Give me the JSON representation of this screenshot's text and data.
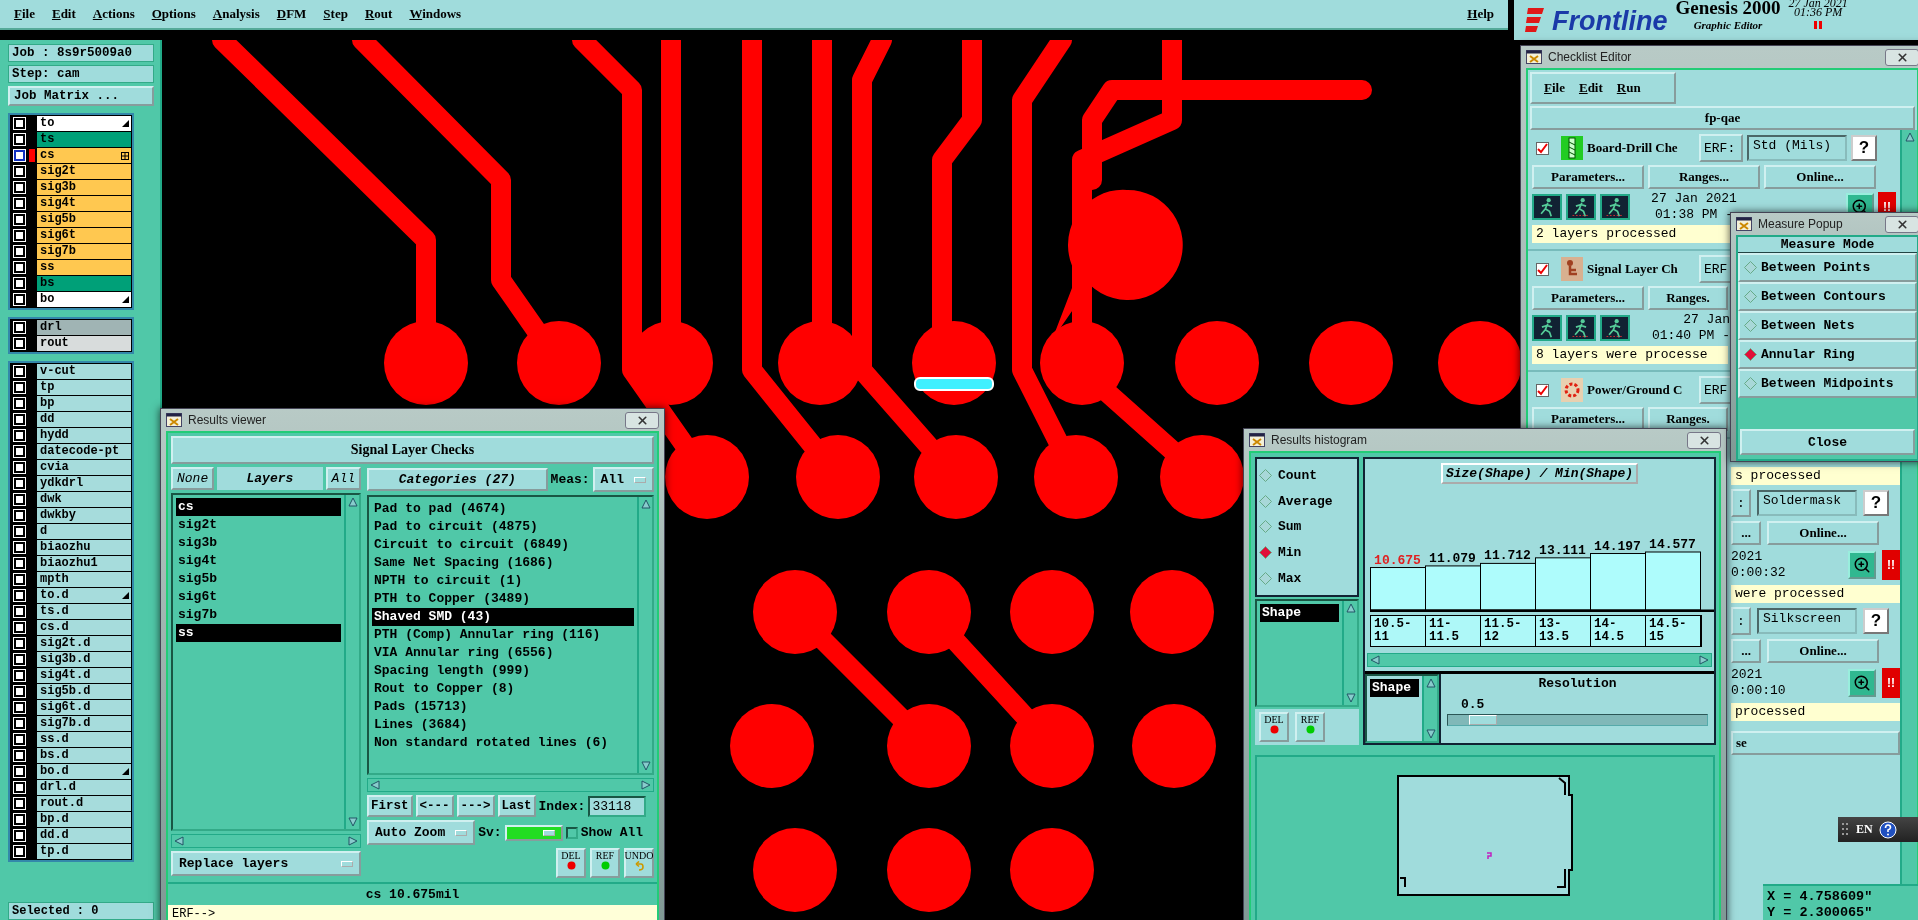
{
  "menu_bar": {
    "items": [
      "File",
      "Edit",
      "Actions",
      "Options",
      "Analysis",
      "DFM",
      "Step",
      "Rout",
      "Windows"
    ],
    "help": "Help"
  },
  "brand": {
    "logo": "Frontline",
    "product": "Genesis 2000",
    "subtitle": "Graphic Editor",
    "date": "27 Jan 2021",
    "time": "01:36 PM"
  },
  "job_panel": {
    "job": "Job : 8s9r5009a0",
    "step": "Step: cam",
    "matrix_button": "Job Matrix ...",
    "layer_groups": [
      [
        {
          "name": "to",
          "color": "#ffffff",
          "checked": false,
          "active": false,
          "marked": true
        },
        {
          "name": "ts",
          "color": "#00a078",
          "checked": false,
          "active": false,
          "marked": false
        },
        {
          "name": "cs",
          "color": "#ffc850",
          "checked": false,
          "active": true,
          "marked": false
        },
        {
          "name": "sig2t",
          "color": "#ffc850",
          "checked": false,
          "active": false,
          "marked": false
        },
        {
          "name": "sig3b",
          "color": "#ffc850",
          "checked": false,
          "active": false,
          "marked": false
        },
        {
          "name": "sig4t",
          "color": "#ffc850",
          "checked": false,
          "active": false,
          "marked": false
        },
        {
          "name": "sig5b",
          "color": "#ffc850",
          "checked": false,
          "active": false,
          "marked": false
        },
        {
          "name": "sig6t",
          "color": "#ffc850",
          "checked": false,
          "active": false,
          "marked": false
        },
        {
          "name": "sig7b",
          "color": "#ffc850",
          "checked": false,
          "active": false,
          "marked": false
        },
        {
          "name": "ss",
          "color": "#ffc850",
          "checked": false,
          "active": false,
          "marked": false
        },
        {
          "name": "bs",
          "color": "#00a078",
          "checked": false,
          "active": false,
          "marked": false
        },
        {
          "name": "bo",
          "color": "#ffffff",
          "checked": false,
          "active": false,
          "marked": true
        }
      ],
      [
        {
          "name": "drl",
          "color": "#a0b4b4",
          "checked": false,
          "active": false,
          "marked": false
        },
        {
          "name": "rout",
          "color": "#d8dcdc",
          "checked": false,
          "active": false,
          "marked": false
        }
      ],
      [
        {
          "name": "v-cut",
          "color": "#a6dcdc",
          "checked": false,
          "active": false,
          "marked": false
        },
        {
          "name": "tp",
          "color": "#a6dcdc",
          "checked": false,
          "active": false,
          "marked": false
        },
        {
          "name": "bp",
          "color": "#a6dcdc",
          "checked": false,
          "active": false,
          "marked": false
        },
        {
          "name": "dd",
          "color": "#a6dcdc",
          "checked": false,
          "active": false,
          "marked": false
        },
        {
          "name": "hydd",
          "color": "#a6dcdc",
          "checked": false,
          "active": false,
          "marked": false
        },
        {
          "name": "datecode-pt",
          "color": "#a6dcdc",
          "checked": false,
          "active": false,
          "marked": false
        },
        {
          "name": "cvia",
          "color": "#a6dcdc",
          "checked": false,
          "active": false,
          "marked": false
        },
        {
          "name": "ydkdrl",
          "color": "#a6dcdc",
          "checked": false,
          "active": false,
          "marked": false
        },
        {
          "name": "dwk",
          "color": "#a6dcdc",
          "checked": false,
          "active": false,
          "marked": false
        },
        {
          "name": "dwkby",
          "color": "#a6dcdc",
          "checked": false,
          "active": false,
          "marked": false
        },
        {
          "name": "d",
          "color": "#a6dcdc",
          "checked": false,
          "active": false,
          "marked": false
        },
        {
          "name": "biaozhu",
          "color": "#a6dcdc",
          "checked": false,
          "active": false,
          "marked": false
        },
        {
          "name": "biaozhu1",
          "color": "#a6dcdc",
          "checked": false,
          "active": false,
          "marked": false
        },
        {
          "name": "mpth",
          "color": "#a6dcdc",
          "checked": false,
          "active": false,
          "marked": false
        },
        {
          "name": "to.d",
          "color": "#a6dcdc",
          "checked": false,
          "active": false,
          "marked": true
        },
        {
          "name": "ts.d",
          "color": "#a6dcdc",
          "checked": false,
          "active": false,
          "marked": false
        },
        {
          "name": "cs.d",
          "color": "#a6dcdc",
          "checked": false,
          "active": false,
          "marked": false
        },
        {
          "name": "sig2t.d",
          "color": "#a6dcdc",
          "checked": false,
          "active": false,
          "marked": false
        },
        {
          "name": "sig3b.d",
          "color": "#a6dcdc",
          "checked": false,
          "active": false,
          "marked": false
        },
        {
          "name": "sig4t.d",
          "color": "#a6dcdc",
          "checked": false,
          "active": false,
          "marked": false
        },
        {
          "name": "sig5b.d",
          "color": "#a6dcdc",
          "checked": false,
          "active": false,
          "marked": false
        },
        {
          "name": "sig6t.d",
          "color": "#a6dcdc",
          "checked": false,
          "active": false,
          "marked": false
        },
        {
          "name": "sig7b.d",
          "color": "#a6dcdc",
          "checked": false,
          "active": false,
          "marked": false
        },
        {
          "name": "ss.d",
          "color": "#a6dcdc",
          "checked": false,
          "active": false,
          "marked": false
        },
        {
          "name": "bs.d",
          "color": "#a6dcdc",
          "checked": false,
          "active": false,
          "marked": false
        },
        {
          "name": "bo.d",
          "color": "#a6dcdc",
          "checked": false,
          "active": false,
          "marked": true
        },
        {
          "name": "drl.d",
          "color": "#a6dcdc",
          "checked": false,
          "active": false,
          "marked": false
        },
        {
          "name": "rout.d",
          "color": "#a6dcdc",
          "checked": false,
          "active": false,
          "marked": false
        },
        {
          "name": "bp.d",
          "color": "#a6dcdc",
          "checked": false,
          "active": false,
          "marked": false
        },
        {
          "name": "dd.d",
          "color": "#a6dcdc",
          "checked": false,
          "active": false,
          "marked": false
        },
        {
          "name": "tp.d",
          "color": "#a6dcdc",
          "checked": false,
          "active": false,
          "marked": false
        }
      ]
    ],
    "selected": "Selected : 0"
  },
  "results_viewer": {
    "title": "Results viewer",
    "heading": "Signal Layer Checks",
    "none_button": "None",
    "layers_label": "Layers",
    "all_button": "All",
    "layers": [
      {
        "name": "cs",
        "selected": true
      },
      {
        "name": "sig2t",
        "selected": false
      },
      {
        "name": "sig3b",
        "selected": false
      },
      {
        "name": "sig4t",
        "selected": false
      },
      {
        "name": "sig5b",
        "selected": false
      },
      {
        "name": "sig6t",
        "selected": false
      },
      {
        "name": "sig7b",
        "selected": false
      },
      {
        "name": "ss",
        "selected": true
      }
    ],
    "categories_button": "Categories (27)",
    "meas_label": "Meas:",
    "meas_value": "All",
    "categories": [
      {
        "name": "Pad to pad (4674)",
        "selected": false
      },
      {
        "name": "Pad to circuit (4875)",
        "selected": false
      },
      {
        "name": "Circuit to circuit (6849)",
        "selected": false
      },
      {
        "name": "Same Net Spacing (1686)",
        "selected": false
      },
      {
        "name": "NPTH to circuit (1)",
        "selected": false
      },
      {
        "name": "PTH to Copper (3489)",
        "selected": false
      },
      {
        "name": "Shaved SMD (43)",
        "selected": true
      },
      {
        "name": "PTH (Comp) Annular ring (116)",
        "selected": false
      },
      {
        "name": "VIA Annular ring (6556)",
        "selected": false
      },
      {
        "name": "Spacing length (999)",
        "selected": false
      },
      {
        "name": "Rout to Copper (8)",
        "selected": false
      },
      {
        "name": "Pads (15713)",
        "selected": false
      },
      {
        "name": "Lines (3684)",
        "selected": false
      },
      {
        "name": "Non standard rotated lines (6)",
        "selected": false
      }
    ],
    "nav": [
      "First",
      "<---",
      "--->",
      "Last"
    ],
    "index_label": "Index:",
    "index_value": "33118",
    "zoom_mode": "Auto Zoom",
    "sv_label": "Sv:",
    "show_all": {
      "label": "Show All",
      "checked": false
    },
    "replace_mode": "Replace layers",
    "tools": [
      {
        "label": "DEL",
        "kind": "delete"
      },
      {
        "label": "REF",
        "kind": "refresh"
      },
      {
        "label": "UNDO",
        "kind": "undo"
      }
    ],
    "status": "cs 10.675mil",
    "erf_prompt": "ERF-->"
  },
  "checklist_editor": {
    "title": "Checklist Editor",
    "menu": [
      "File",
      "Edit",
      "Run"
    ],
    "name": "fp-qae",
    "checks": [
      {
        "name": "Board-Drill Che",
        "kind": "drill",
        "checked": true,
        "erf_label": "ERF:",
        "erf_value": "Std (Mils)",
        "help": "?",
        "buttons": [
          "Parameters...",
          "Ranges...",
          "Online..."
        ],
        "date": "27 Jan 2021",
        "time": "01:38 PM -",
        "alert": "!!",
        "status": "2 layers processed"
      },
      {
        "name": "Signal Layer Ch",
        "kind": "signal",
        "checked": true,
        "erf_label": "ERF",
        "buttons": [
          "Parameters...",
          "Ranges."
        ],
        "date": "27 Jan",
        "time": "01:40 PM -",
        "status": "8 layers were processe"
      },
      {
        "name": "Power/Ground C",
        "kind": "power",
        "checked": true,
        "erf_label": "ERF",
        "buttons": [
          "Parameters...",
          "Ranges."
        ]
      }
    ],
    "partial_status": "s processed",
    "partial_checks": [
      {
        "erf_label": ":",
        "erf_value": "Soldermask",
        "help": "?",
        "buttons": [
          "...",
          "Online..."
        ],
        "date": "2021",
        "time": "0:00:32",
        "alert": "!!",
        "status": "were processed"
      },
      {
        "erf_label": ":",
        "erf_value": "Silkscreen",
        "help": "?",
        "buttons": [
          "...",
          "Online..."
        ],
        "date": "2021",
        "time": "0:00:10",
        "alert": "!!",
        "status": "processed"
      }
    ],
    "close_button": "se"
  },
  "measure_popup": {
    "title": "Measure Popup",
    "heading": "Measure Mode",
    "modes": [
      {
        "label": "Between Points",
        "selected": false
      },
      {
        "label": "Between Contours",
        "selected": false
      },
      {
        "label": "Between Nets",
        "selected": false
      },
      {
        "label": "Annular Ring",
        "selected": true
      },
      {
        "label": "Between Midpoints",
        "selected": false
      }
    ],
    "close": "Close"
  },
  "results_histogram": {
    "title": "Results histogram",
    "functions": [
      {
        "label": "Count",
        "selected": false
      },
      {
        "label": "Average",
        "selected": false
      },
      {
        "label": "Sum",
        "selected": false
      },
      {
        "label": "Min",
        "selected": true
      },
      {
        "label": "Max",
        "selected": false
      }
    ],
    "fields": [
      {
        "name": "Shape",
        "selected": true
      }
    ],
    "tools": [
      {
        "label": "DEL",
        "kind": "delete"
      },
      {
        "label": "REF",
        "kind": "refresh"
      }
    ],
    "chart_data": {
      "type": "bar",
      "title": "Size(Shape) / Min(Shape)",
      "categories": [
        "10.5-11",
        "11-11.5",
        "11.5-12",
        "13-13.5",
        "14-14.5",
        "14.5-15"
      ],
      "values": [
        10.675,
        11.079,
        11.712,
        13.111,
        14.197,
        14.577
      ],
      "data_labels": true
    },
    "group_fields": [
      {
        "name": "Shape",
        "selected": true
      }
    ],
    "resolution": {
      "label": "Resolution",
      "value": "0.5",
      "level": 0.08
    }
  },
  "ime_bar": {
    "language": "EN"
  },
  "coordinates": {
    "x": "X = 4.758609\"",
    "y": "Y = 2.300065\""
  }
}
